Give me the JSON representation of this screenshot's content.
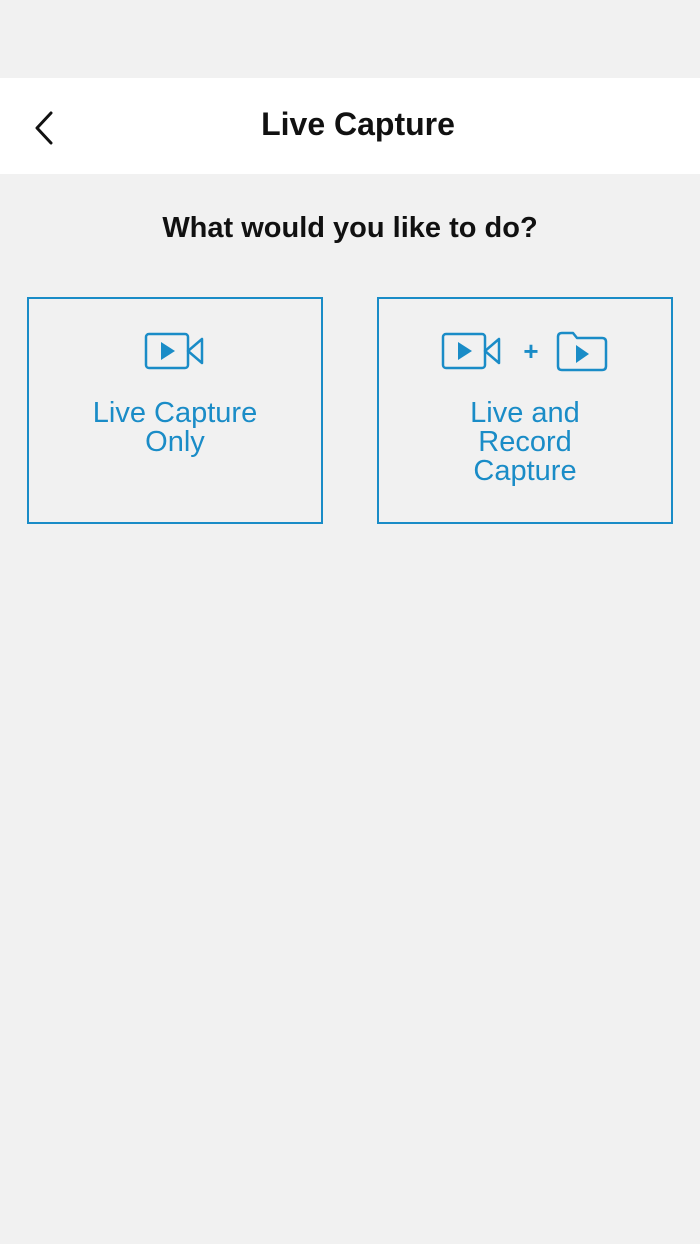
{
  "header": {
    "title": "Live Capture",
    "back_icon": "chevron-left-icon"
  },
  "prompt": "What would you like to do?",
  "options": [
    {
      "label_lines": [
        "Live Capture",
        "Only"
      ],
      "icons": [
        "video-camera-icon"
      ]
    },
    {
      "label_lines": [
        "Live and",
        "Record",
        "Capture"
      ],
      "icons": [
        "video-camera-icon",
        "plus",
        "video-folder-icon"
      ],
      "plus": "+"
    }
  ],
  "colors": {
    "accent": "#1a8cc7",
    "background": "#f1f1f1",
    "header_bg": "#ffffff",
    "text": "#111111"
  }
}
